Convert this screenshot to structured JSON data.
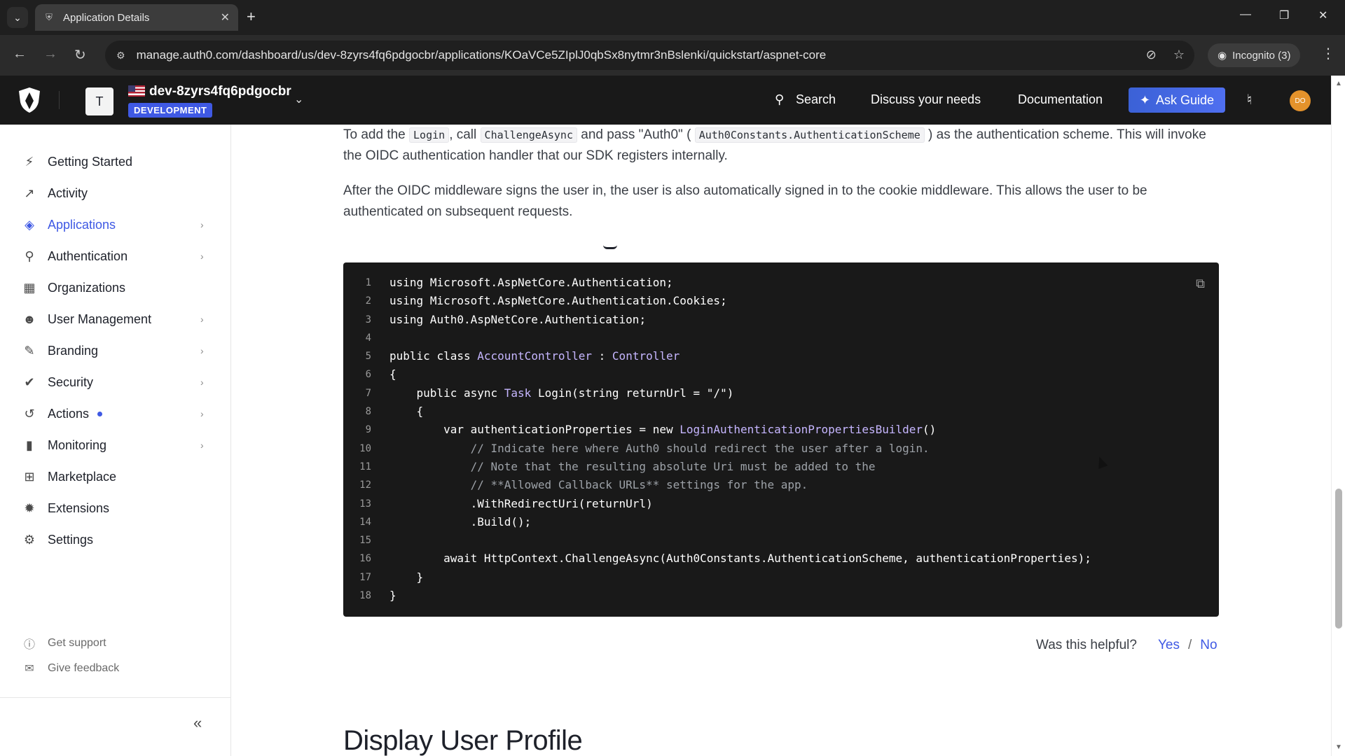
{
  "browser": {
    "tab_title": "Application Details",
    "url": "manage.auth0.com/dashboard/us/dev-8zyrs4fq6pdgocbr/applications/KOaVCe5ZIplJ0qbSx8nytmr3nBslenki/quickstart/aspnet-core",
    "incognito_label": "Incognito (3)"
  },
  "header": {
    "tenant_initial": "T",
    "tenant_name": "dev-8zyrs4fq6pdgocbr",
    "environment_badge": "DEVELOPMENT",
    "search_label": "Search",
    "discuss_label": "Discuss your needs",
    "documentation_label": "Documentation",
    "ask_guide_label": "Ask Guide",
    "user_initials": "DO",
    "accent_color": "#3f59e4"
  },
  "sidebar": {
    "items": [
      {
        "label": "Getting Started",
        "icon": "bolt-icon",
        "has_chevron": false
      },
      {
        "label": "Activity",
        "icon": "activity-chart-icon",
        "has_chevron": false
      },
      {
        "label": "Applications",
        "icon": "layers-icon",
        "has_chevron": true,
        "active": true
      },
      {
        "label": "Authentication",
        "icon": "lock-icon",
        "has_chevron": true
      },
      {
        "label": "Organizations",
        "icon": "building-icon",
        "has_chevron": false
      },
      {
        "label": "User Management",
        "icon": "users-icon",
        "has_chevron": true
      },
      {
        "label": "Branding",
        "icon": "brush-icon",
        "has_chevron": true
      },
      {
        "label": "Security",
        "icon": "shield-check-icon",
        "has_chevron": true
      },
      {
        "label": "Actions",
        "icon": "flow-icon",
        "has_chevron": true,
        "dot": true
      },
      {
        "label": "Monitoring",
        "icon": "bar-chart-icon",
        "has_chevron": true
      },
      {
        "label": "Marketplace",
        "icon": "grid-plus-icon",
        "has_chevron": false
      },
      {
        "label": "Extensions",
        "icon": "puzzle-icon",
        "has_chevron": false
      },
      {
        "label": "Settings",
        "icon": "gear-icon",
        "has_chevron": false
      }
    ],
    "get_support": "Get support",
    "give_feedback": "Give feedback"
  },
  "main": {
    "para1_parts": [
      "To add the ",
      "Login",
      ", call ",
      "ChallengeAsync",
      " and pass \"Auth0\" ( ",
      "Auth0Constants.AuthenticationScheme",
      " ) as the authentication scheme. This will invoke the OIDC authentication handler that our SDK registers internally."
    ],
    "para2": "After the OIDC middleware signs the user in, the user is also automatically signed in to the cookie middleware. This allows the user to be authenticated on subsequent requests.",
    "code_lines": [
      "using Microsoft.AspNetCore.Authentication;",
      "using Microsoft.AspNetCore.Authentication.Cookies;",
      "using Auth0.AspNetCore.Authentication;",
      "",
      "public class AccountController : Controller",
      "{",
      "    public async Task Login(string returnUrl = \"/\")",
      "    {",
      "        var authenticationProperties = new LoginAuthenticationPropertiesBuilder()",
      "            // Indicate here where Auth0 should redirect the user after a login.",
      "            // Note that the resulting absolute Uri must be added to the",
      "            // **Allowed Callback URLs** settings for the app.",
      "            .WithRedirectUri(returnUrl)",
      "            .Build();",
      "",
      "        await HttpContext.ChallengeAsync(Auth0Constants.AuthenticationScheme, authenticationProperties);",
      "    }",
      "}"
    ],
    "helpful_question": "Was this helpful?",
    "helpful_yes": "Yes",
    "helpful_separator": "/",
    "helpful_no": "No",
    "next_section_title": "Display User Profile"
  }
}
